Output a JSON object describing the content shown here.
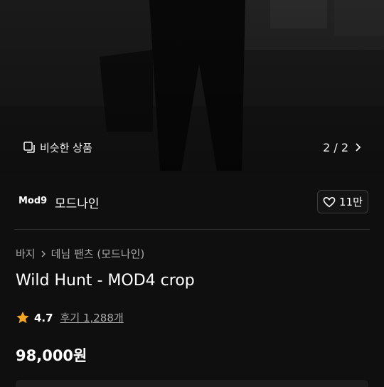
{
  "hero": {
    "similar_label": "비슷한 상품",
    "pager_text": "2 / 2"
  },
  "brand": {
    "logo_text": "Mod9",
    "name": "모드나인",
    "like_count": "11만"
  },
  "breadcrumb": {
    "category": "바지",
    "subcategory": "데님 팬츠 (모드나인)"
  },
  "product": {
    "title": "Wild Hunt - MOD4 crop",
    "rating": "4.7",
    "review_label": "후기 1,288개",
    "price": "98,000원"
  },
  "colors": {
    "background": "#0f0f0f",
    "star": "#f5a623",
    "muted_text": "#a9a9a9",
    "border": "#3c3c3c"
  },
  "icons": {
    "similar": "copy-icon",
    "pager": "chevron-right-icon",
    "like": "heart-outline-icon",
    "breadcrumb_separator": "chevron-right-icon",
    "rating": "star-icon"
  }
}
